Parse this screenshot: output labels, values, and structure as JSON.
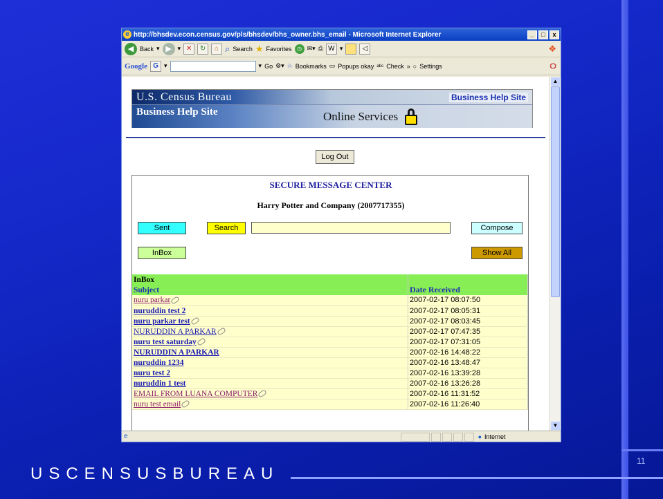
{
  "browser": {
    "title": "http://bhsdev.econ.census.gov/pls/bhsdev/bhs_owner.bhs_email - Microsoft Internet Explorer",
    "window_controls": [
      "_",
      "□",
      "x"
    ],
    "toolbar": {
      "back": "Back",
      "search": "Search",
      "favorites": "Favorites"
    },
    "google_bar": {
      "logo": "Google",
      "g_menu": "G",
      "go": "Go",
      "bookmarks": "Bookmarks",
      "popups": "Popups okay",
      "check": "Check",
      "settings": "Settings",
      "more": "»"
    },
    "status": {
      "zone": "Internet"
    }
  },
  "header": {
    "agency": "U.S. Census Bureau",
    "top_right": "Business Help Site",
    "site_name": "Business Help Site",
    "section": "Online Services"
  },
  "logout_label": "Log Out",
  "message_center": {
    "title": "SECURE MESSAGE CENTER",
    "company": "Harry Potter and Company (2007717355)",
    "buttons": {
      "sent": "Sent",
      "search": "Search",
      "compose": "Compose",
      "inbox": "InBox",
      "show_all": "Show All"
    },
    "search_value": ""
  },
  "inbox": {
    "section_label": "InBox",
    "col_subject": "Subject",
    "col_date": "Date Received",
    "rows": [
      {
        "subject": "nuru parkar",
        "date": "2007-02-17 08:07:50",
        "attachment": true,
        "read": true,
        "bold": false
      },
      {
        "subject": "nuruddin test 2",
        "date": "2007-02-17 08:05:31",
        "attachment": false,
        "read": false,
        "bold": true
      },
      {
        "subject": "nuru parkar test",
        "date": "2007-02-17 08:03:45",
        "attachment": true,
        "read": false,
        "bold": true
      },
      {
        "subject": "NURUDDIN A PARKAR",
        "date": "2007-02-17 07:47:35",
        "attachment": true,
        "read": false,
        "bold": false
      },
      {
        "subject": "nuru test saturday",
        "date": "2007-02-17 07:31:05",
        "attachment": true,
        "read": false,
        "bold": true
      },
      {
        "subject": "NURUDDIN A PARKAR",
        "date": "2007-02-16 14:48:22",
        "attachment": false,
        "read": false,
        "bold": true
      },
      {
        "subject": "nuruddin 1234",
        "date": "2007-02-16 13:48:47",
        "attachment": false,
        "read": false,
        "bold": true
      },
      {
        "subject": "nuru test 2",
        "date": "2007-02-16 13:39:28",
        "attachment": false,
        "read": false,
        "bold": true
      },
      {
        "subject": "nuruddin 1 test",
        "date": "2007-02-16 13:26:28",
        "attachment": false,
        "read": false,
        "bold": true
      },
      {
        "subject": "EMAIL FROM LUANA COMPUTER",
        "date": "2007-02-16 11:31:52",
        "attachment": true,
        "read": true,
        "bold": false
      },
      {
        "subject": "nuru test email",
        "date": "2007-02-16 11:26:40",
        "attachment": true,
        "read": true,
        "bold": false
      }
    ]
  },
  "slide": {
    "footer_brand": "USCENSUSBUREAU",
    "page_number": "11"
  },
  "colors": {
    "unread_link": "#1a1ab4",
    "read_link": "#8a1a6a",
    "sent_btn": "#33ffff",
    "search_btn": "#ffff00",
    "compose_btn": "#ccffff",
    "inbox_btn": "#ccff99",
    "showall_btn": "#cc9900",
    "table_header": "#88ee55"
  }
}
